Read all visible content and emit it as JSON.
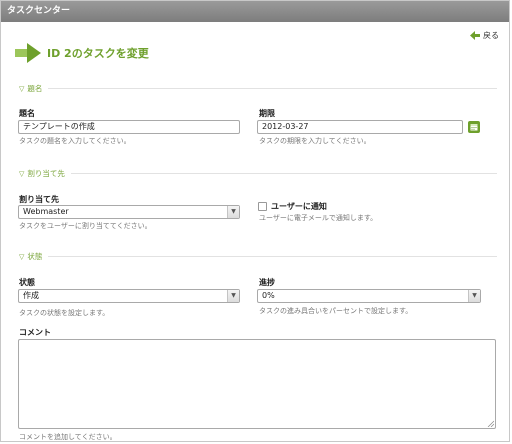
{
  "window": {
    "title": "タスクセンター"
  },
  "header": {
    "back_label": "戻る",
    "page_title": "ID 2のタスクを変更"
  },
  "sections": {
    "subject": {
      "legend": "題名"
    },
    "assign": {
      "legend": "割り当て先"
    },
    "status": {
      "legend": "状態"
    }
  },
  "fields": {
    "title": {
      "label": "題名",
      "value": "テンプレートの作成",
      "hint": "タスクの題名を入力してください。"
    },
    "due": {
      "label": "期限",
      "value": "2012-03-27",
      "hint": "タスクの期限を入力してください。"
    },
    "assignee": {
      "label": "割り当て先",
      "value": "Webmaster",
      "hint": "タスクをユーザーに割り当ててください。"
    },
    "notify": {
      "label": "ユーザーに通知",
      "checked": false,
      "hint": "ユーザーに電子メールで通知します。"
    },
    "state": {
      "label": "状態",
      "value": "作成",
      "hint": "タスクの状態を設定します。"
    },
    "progress": {
      "label": "進捗",
      "value": "0%",
      "hint": "タスクの進み具合いをパーセントで設定します。"
    },
    "comment": {
      "label": "コメント",
      "value": "",
      "hint": "コメントを追加してください。"
    }
  },
  "colors": {
    "accent": "#6ea02c",
    "titlebar": "#8a8a8a"
  }
}
